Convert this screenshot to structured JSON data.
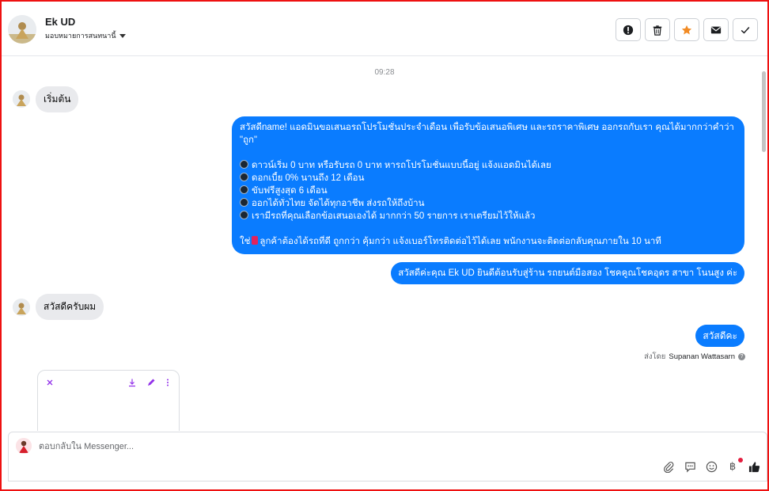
{
  "header": {
    "contact_name": "Ek UD",
    "assign_label": "มอบหมายการสนทนานี้",
    "actions": [
      "spam-icon",
      "trash-icon",
      "star-icon",
      "mail-icon",
      "check-icon"
    ]
  },
  "colors": {
    "outgoing_bubble": "#0a7cff",
    "incoming_bubble": "#e9eaed",
    "star": "#f28b24",
    "card_icons": "#9333ea"
  },
  "chat": {
    "timestamp": "09:28",
    "messages": [
      {
        "direction": "in",
        "text": "เริ่มต้น"
      },
      {
        "direction": "out",
        "lines": [
          {
            "text": "สวัสดีname! แอดมินขอเสนอรถโปรโมชั่นประจำเดือน เพื่อรับข้อเสนอพิเศษ และรถราคาพิเศษ ออกรถกับเรา คุณได้มากกว่าคำว่า",
            "icon": ""
          },
          {
            "text": "\"ถูก\"",
            "icon": ""
          },
          {
            "text": "",
            "icon": ""
          },
          {
            "text": "ดาวน์เริ่ม 0 บาท หรือรับรถ 0 บาท หารถโปรโมชั่นแบบนี้อยู่ แจ้งแอดมินได้เลย",
            "icon": "bullet-icon"
          },
          {
            "text": "ดอกเบี้ย 0% นานถึง 12 เดือน",
            "icon": "bullet-icon"
          },
          {
            "text": "ขับฟรีสูงสุด 6 เดือน",
            "icon": "bullet-icon"
          },
          {
            "text": "ออกได้ทั่วไทย จัดได้ทุกอาชีพ ส่งรถให้ถึงบ้าน",
            "icon": "bullet-icon"
          },
          {
            "text": "เรามีรถที่คุณเลือกข้อเสนอเองได้ มากกว่า 50 รายการ เราเตรียมไว้ให้แล้ว",
            "icon": "bullet-icon"
          },
          {
            "text": "",
            "icon": ""
          }
        ],
        "last_line_prefix": "ใช่",
        "last_line_text": "ลูกค้าต้องได้รถที่ดี ถูกกว่า คุ้มกว่า แจ้งเบอร์โทรติดต่อไว้ได้เลย พนักงานจะติดต่อกลับคุณภายใน 10 นาที"
      },
      {
        "direction": "out",
        "text": "สวัสดีค่ะคุณ Ek UD ยินดีต้อนรับสู่ร้าน รถยนต์มือสอง โชคคูณโชคอุดร สาขา โนนสูง ค่ะ"
      },
      {
        "direction": "in",
        "text": "สวัสดีครับผม"
      },
      {
        "direction": "out",
        "text": "สวัสดีคะ"
      }
    ],
    "sent_by_label": "ส่งโดย",
    "sent_by_name": "Supanan Wattasarn",
    "card_icons": [
      "close-icon",
      "download-icon",
      "edit-icon",
      "more-icon"
    ]
  },
  "composer": {
    "placeholder": "ตอบกลับใน Messenger...",
    "value": "",
    "tools": [
      "attachment-icon",
      "saved-replies-icon",
      "emoji-icon",
      "baht-icon",
      "like-icon"
    ],
    "baht_symbol": "฿"
  }
}
